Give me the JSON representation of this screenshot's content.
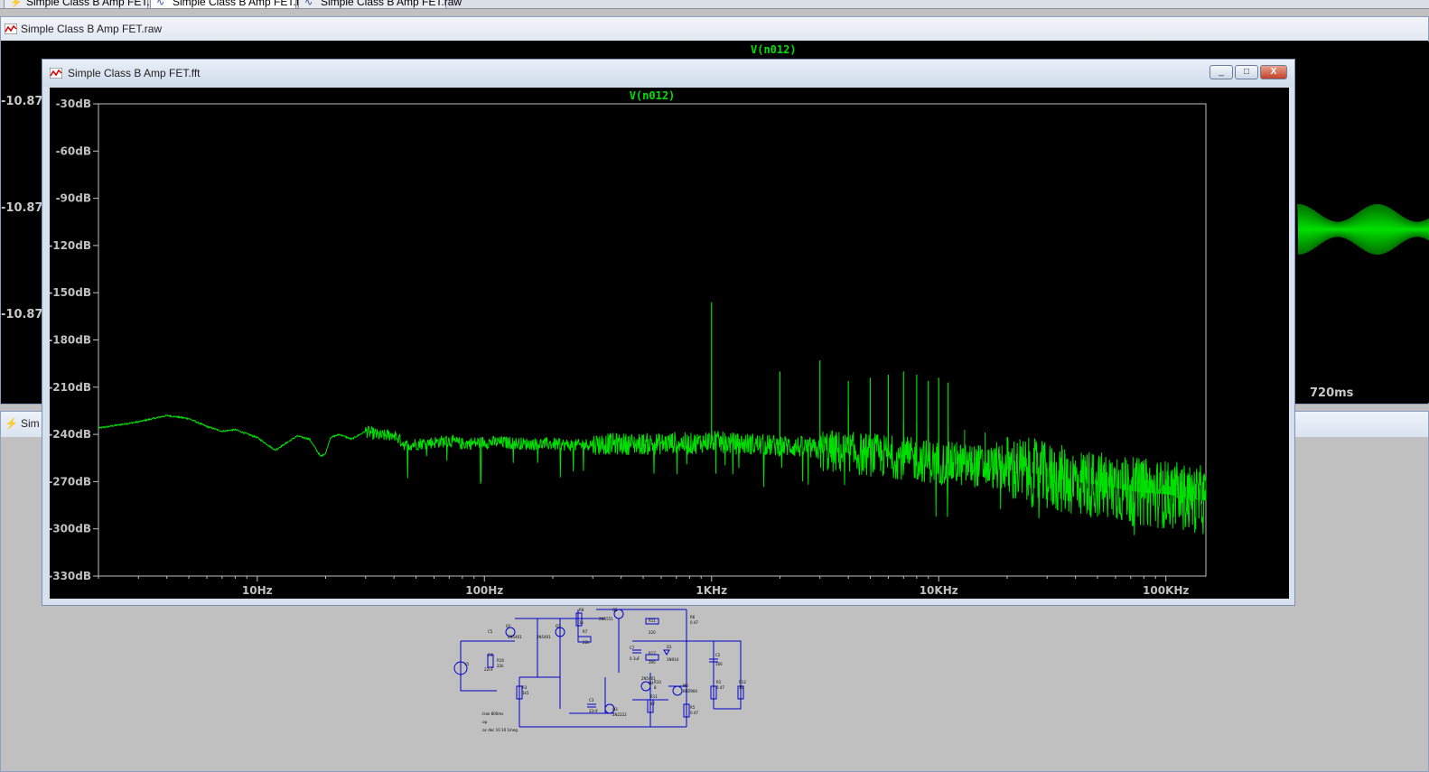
{
  "tabs": [
    {
      "label": "Simple Class B Amp FET.asc",
      "active": false
    },
    {
      "label": "Simple Class B Amp FET.fft",
      "active": true
    },
    {
      "label": "Simple Class B Amp FET.raw",
      "active": false
    }
  ],
  "raw_window": {
    "title": "Simple Class B Amp FET.raw",
    "trace": "V(n012)",
    "y_ticks": [
      "-10.87",
      "-10.87",
      "-10.87"
    ],
    "x_tick": "720ms"
  },
  "schematic_window": {
    "title": "Simple Class B Amp FET.asc",
    "visible_title": "Sim",
    "components": [
      "Q1",
      "Q2",
      "Q3",
      "Q4",
      "Q5",
      "R1",
      "R3",
      "R5",
      "R6",
      "R7",
      "R8",
      "R10",
      "R11",
      "R12",
      "R16",
      "R17",
      "C2",
      "C3",
      "C4",
      "C5",
      "C7",
      "D1",
      "M2",
      "V1",
      "2N5401",
      "2N5551",
      "2N2222",
      "1N914",
      "BUZ904",
      "1k5",
      "22k",
      "1k",
      "47",
      "0.47",
      "10",
      "8",
      "220",
      "390",
      "166",
      "0.1uF",
      "22nF",
      "33nF",
      "22k"
    ],
    "directives": [
      ".tran 800ms",
      ".op",
      ".ac dec 10 10 1meg"
    ]
  },
  "fft_window": {
    "title": "Simple Class B Amp FET.fft",
    "buttons": {
      "minimize": "_",
      "maximize": "□",
      "close": "X"
    },
    "trace": "V(n012)"
  },
  "chart_data": {
    "type": "line",
    "title": "V(n012)",
    "xscale": "log",
    "xlim": [
      2,
      150000
    ],
    "ylim": [
      -330,
      -30
    ],
    "x_ticks": [
      "10Hz",
      "100Hz",
      "1KHz",
      "10KHz",
      "100KHz"
    ],
    "x_tick_values": [
      10,
      100,
      1000,
      10000,
      100000
    ],
    "y_ticks": [
      "-30dB",
      "-60dB",
      "-90dB",
      "-120dB",
      "-150dB",
      "-180dB",
      "-210dB",
      "-240dB",
      "-270dB",
      "-300dB",
      "-330dB"
    ],
    "y_tick_values": [
      -30,
      -60,
      -90,
      -120,
      -150,
      -180,
      -210,
      -240,
      -270,
      -300,
      -330
    ],
    "series": [
      {
        "name": "V(n012)",
        "color": "#00e000",
        "x": [
          2,
          3,
          4,
          5,
          6,
          7,
          8,
          10,
          12,
          15,
          17,
          19,
          20,
          21,
          23,
          26,
          30,
          35,
          40,
          45,
          50,
          60,
          70,
          80,
          100,
          120,
          150,
          200,
          250,
          300,
          400,
          500,
          600,
          700,
          800,
          900,
          1000,
          1100,
          1300,
          1500,
          1800,
          2000,
          2500,
          3000,
          3500,
          4000,
          5000,
          6000,
          7000,
          8000,
          10000,
          12000,
          15000,
          20000,
          25000,
          30000,
          40000,
          50000,
          60000,
          70000,
          80000,
          100000,
          120000,
          150000
        ],
        "y": [
          -236,
          -232,
          -228,
          -230,
          -235,
          -238,
          -237,
          -242,
          -250,
          -241,
          -243,
          -254,
          -252,
          -242,
          -240,
          -243,
          -238,
          -241,
          -240,
          -247,
          -246,
          -245,
          -244,
          -246,
          -245,
          -245,
          -246,
          -246,
          -247,
          -246,
          -246,
          -246,
          -246,
          -245,
          -246,
          -245,
          -244,
          -245,
          -246,
          -246,
          -247,
          -247,
          -248,
          -250,
          -251,
          -252,
          -253,
          -254,
          -255,
          -256,
          -258,
          -259,
          -260,
          -262,
          -264,
          -267,
          -270,
          -272,
          -274,
          -276,
          -277,
          -278,
          -280,
          -282
        ]
      }
    ],
    "peaks": [
      {
        "x": 1000,
        "y": -156
      },
      {
        "x": 2000,
        "y": -200
      },
      {
        "x": 3000,
        "y": -193
      },
      {
        "x": 4000,
        "y": -206
      },
      {
        "x": 5000,
        "y": -204
      },
      {
        "x": 6000,
        "y": -202
      },
      {
        "x": 7000,
        "y": -200
      },
      {
        "x": 8000,
        "y": -202
      },
      {
        "x": 9000,
        "y": -206
      },
      {
        "x": 10000,
        "y": -204
      },
      {
        "x": 11000,
        "y": -207
      }
    ]
  },
  "colors": {
    "trace": "#00e000",
    "plot_bg": "#000000",
    "grid_frame": "#c0c0c0",
    "window_chrome": "#d6e0ee",
    "schematic_wire": "#0000cc"
  }
}
